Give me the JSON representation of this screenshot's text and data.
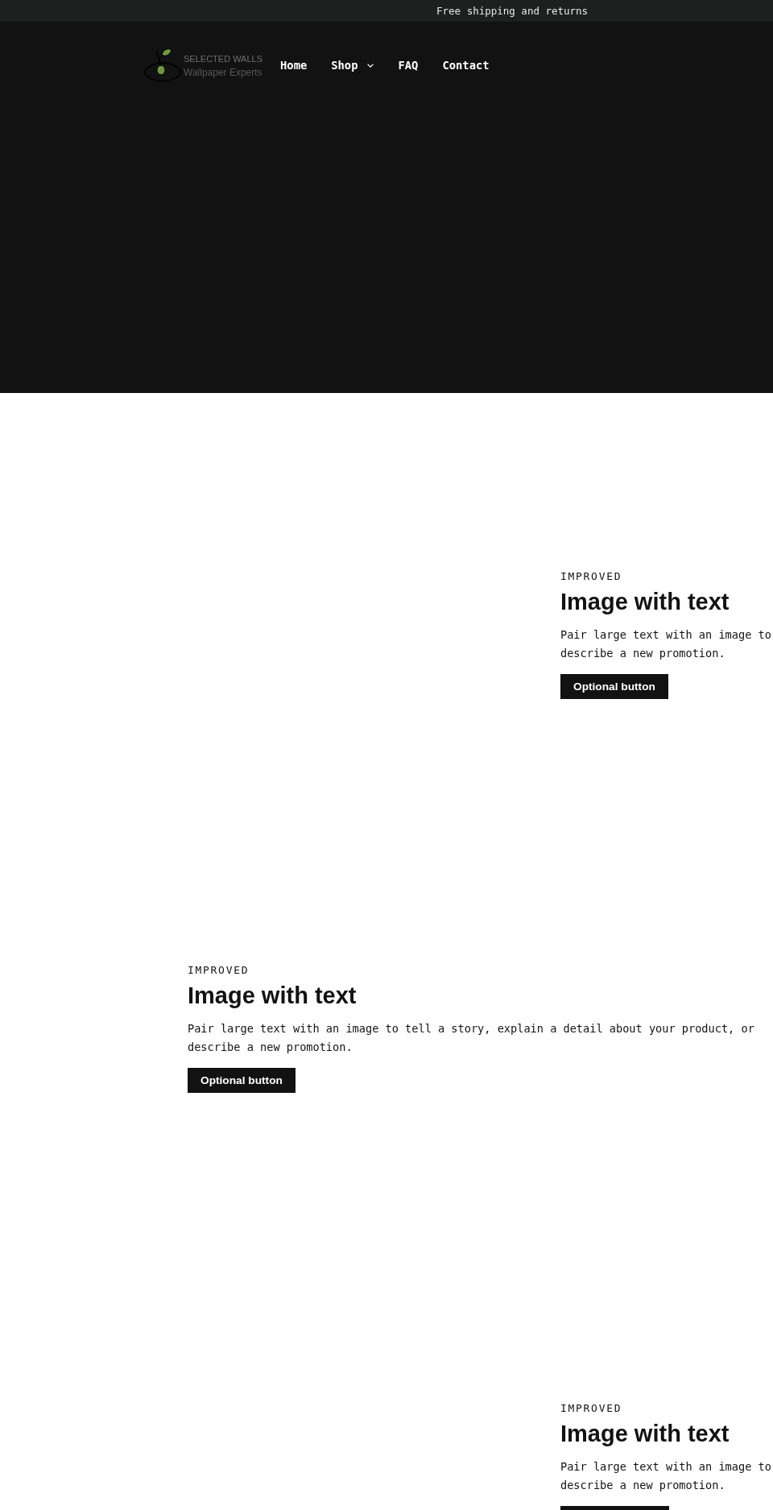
{
  "announcement": {
    "text": "Free shipping and returns"
  },
  "header": {
    "logo": {
      "title": "SELECTED WALLS",
      "tagline": "Wallpaper Experts"
    },
    "nav": [
      {
        "label": "Home",
        "dropdown": false
      },
      {
        "label": "Shop",
        "dropdown": true
      },
      {
        "label": "FAQ",
        "dropdown": false
      },
      {
        "label": "Contact",
        "dropdown": false
      }
    ]
  },
  "sections": [
    {
      "kind": "right",
      "eyebrow": "IMPROVED",
      "heading": "Image with text",
      "text": "Pair large text with an image to describe a new promotion.",
      "button": "Optional button"
    },
    {
      "kind": "left",
      "eyebrow": "IMPROVED",
      "heading": "Image with text",
      "text": "Pair large text with an image to tell a story, explain a detail about your product, or describe a new promotion.",
      "button": "Optional button"
    },
    {
      "kind": "right",
      "eyebrow": "IMPROVED",
      "heading": "Image with text",
      "text": "Pair large text with an image to describe a new promotion.",
      "button_edge": true
    }
  ]
}
